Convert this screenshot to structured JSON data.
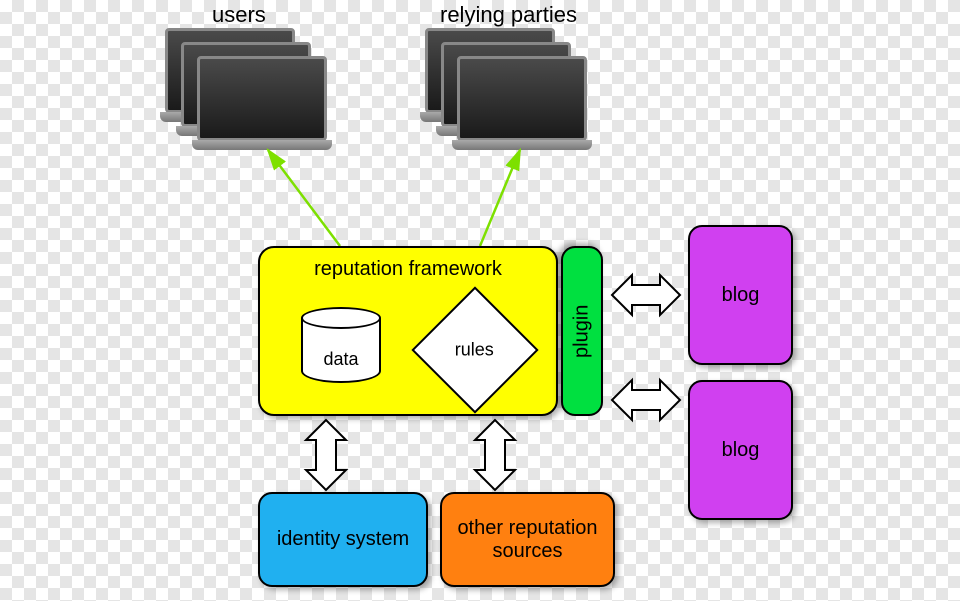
{
  "labels": {
    "users": "users",
    "relying_parties": "relying parties"
  },
  "framework": {
    "title": "reputation framework",
    "data": "data",
    "rules": "rules"
  },
  "plugin": "plugin",
  "blog1": "blog",
  "blog2": "blog",
  "identity": "identity system",
  "other_sources": "other reputation sources"
}
